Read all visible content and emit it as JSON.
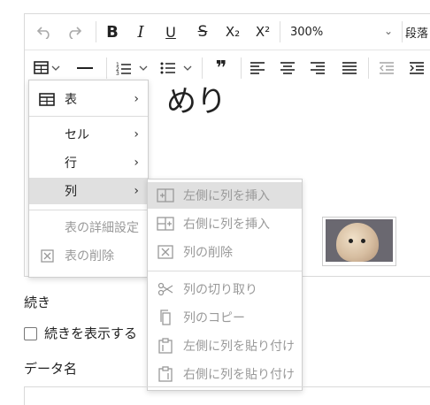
{
  "toolbar": {
    "undo_icon": "undo-icon",
    "redo_icon": "redo-icon",
    "bold": "B",
    "italic": "I",
    "underline": "U",
    "strike": "S",
    "subscript": "X₂",
    "superscript": "X²",
    "font_size_value": "300%",
    "paragraph_label": "段落",
    "table_icon": "table-icon",
    "hr_icon": "horizontal-rule-icon",
    "quote": "❞"
  },
  "editor": {
    "big_text": "めり"
  },
  "table_menu": {
    "items": [
      {
        "label": "表"
      },
      {
        "label": "セル"
      },
      {
        "label": "行"
      },
      {
        "label": "列"
      },
      {
        "label": "表の詳細設定"
      },
      {
        "label": "表の削除"
      }
    ]
  },
  "column_submenu": {
    "items": [
      {
        "label": "左側に列を挿入"
      },
      {
        "label": "右側に列を挿入"
      },
      {
        "label": "列の削除"
      },
      {
        "label": "列の切り取り"
      },
      {
        "label": "列のコピー"
      },
      {
        "label": "左側に列を貼り付け"
      },
      {
        "label": "右側に列を貼り付け"
      }
    ]
  },
  "form": {
    "continue_heading": "続き",
    "show_continue_label": "続きを表示する",
    "data_name_heading": "データ名"
  },
  "colors": {
    "active_item_bg": "#e0e0e0",
    "disabled_text": "#9a9a9a",
    "border": "#d9d9d9"
  }
}
